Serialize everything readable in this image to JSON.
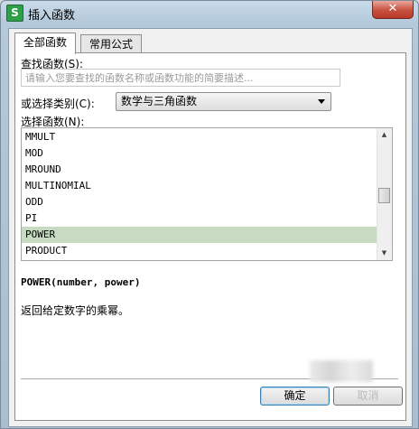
{
  "window": {
    "title": "插入函数",
    "app_icon_glyph": "S",
    "close_glyph": "✕"
  },
  "tabs": [
    {
      "label": "全部函数",
      "active": true
    },
    {
      "label": "常用公式",
      "active": false
    }
  ],
  "search": {
    "label": "查找函数(S):",
    "placeholder": "请输入您要查找的函数名称或函数功能的简要描述..."
  },
  "category": {
    "label": "或选择类别(C):",
    "value": "数学与三角函数"
  },
  "functions": {
    "label": "选择函数(N):",
    "items": [
      "MMULT",
      "MOD",
      "MROUND",
      "MULTINOMIAL",
      "ODD",
      "PI",
      "POWER",
      "PRODUCT"
    ],
    "selected": "POWER"
  },
  "syntax": "POWER(number, power)",
  "description": "返回给定数字的乘幂。",
  "buttons": {
    "ok": "确定",
    "cancel": "取消"
  },
  "colors": {
    "selection": "#c7dbc2",
    "app_icon": "#2e9e48",
    "close_button": "#c7503f"
  },
  "icons": {
    "app": "wps-spreadsheet-icon",
    "close": "close-icon",
    "dropdown": "chevron-down-icon",
    "scroll_up": "arrow-up-icon",
    "scroll_down": "arrow-down-icon"
  }
}
